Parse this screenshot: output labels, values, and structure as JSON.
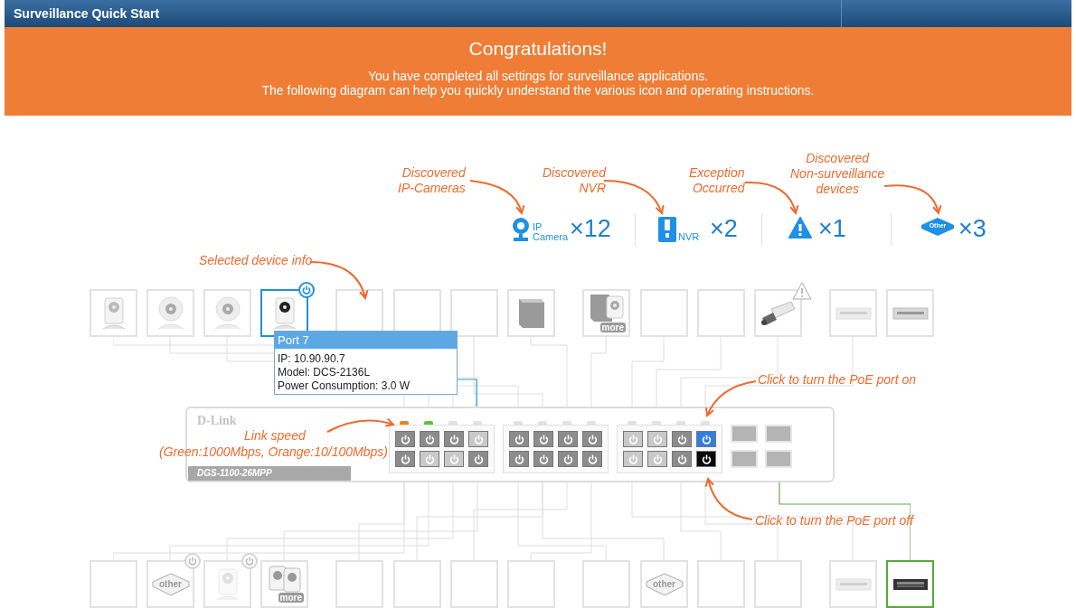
{
  "header": {
    "title": "Surveillance Quick Start"
  },
  "banner": {
    "heading": "Congratulations!",
    "lines": [
      "You have completed all settings for surveillance applications.",
      "The following diagram can help you quickly understand the various icon and operating instructions."
    ]
  },
  "legend": [
    {
      "kind": "camera",
      "label_lines": [
        "Discovered",
        "IP-Cameras"
      ],
      "icon_text": [
        "IP",
        "Camera"
      ],
      "count": "×12"
    },
    {
      "kind": "nvr",
      "label_lines": [
        "Discovered",
        "NVR"
      ],
      "icon_text": [
        "NVR"
      ],
      "count": "×2"
    },
    {
      "kind": "warning",
      "label_lines": [
        "Exception",
        "Occurred"
      ],
      "count": "×1"
    },
    {
      "kind": "other",
      "label_lines": [
        "Discovered",
        "Non-surveillance",
        "devices"
      ],
      "icon_text": [
        "Other"
      ],
      "count": "×3"
    }
  ],
  "callouts": [
    {
      "kind": "selected-info",
      "lines": [
        "Selected device info"
      ]
    },
    {
      "kind": "link-speed",
      "lines": [
        "Link speed",
        "(Green:1000Mbps, Orange:10/100Mbps)"
      ]
    },
    {
      "kind": "poe-on",
      "lines": [
        "Click to turn the PoE port on"
      ]
    },
    {
      "kind": "poe-off",
      "lines": [
        "Click to turn the PoE port off"
      ]
    }
  ],
  "top_devices": [
    {
      "kind": "cube-camera",
      "selected": false,
      "power_badge": false,
      "warning": false
    },
    {
      "kind": "round-camera",
      "selected": false,
      "power_badge": false,
      "warning": false
    },
    {
      "kind": "round-camera",
      "selected": false,
      "power_badge": false,
      "warning": false
    },
    {
      "kind": "cube-camera",
      "selected": true,
      "color": "#1e90e6",
      "power_badge": true,
      "warning": false
    },
    {
      "kind": "empty",
      "selected": false,
      "power_badge": false,
      "warning": false
    },
    {
      "kind": "empty",
      "selected": false,
      "power_badge": false,
      "warning": false
    },
    {
      "kind": "empty",
      "selected": false,
      "power_badge": false,
      "warning": false
    },
    {
      "kind": "nvr",
      "selected": false,
      "power_badge": false,
      "warning": false
    },
    {
      "kind": "nvr-more",
      "selected": false,
      "tag": "more",
      "power_badge": false,
      "warning": false
    },
    {
      "kind": "empty",
      "selected": false,
      "power_badge": false,
      "warning": false
    },
    {
      "kind": "empty",
      "selected": false,
      "power_badge": false,
      "warning": false
    },
    {
      "kind": "bullet-camera",
      "selected": false,
      "power_badge": false,
      "warning": true
    },
    {
      "kind": "switch",
      "selected": false,
      "dimmed": true,
      "power_badge": false,
      "warning": false
    },
    {
      "kind": "switch",
      "selected": false,
      "power_badge": false,
      "warning": false
    }
  ],
  "bottom_devices": [
    {
      "kind": "empty",
      "selected": false,
      "power_badge": false,
      "warning": false
    },
    {
      "kind": "other",
      "selected": false,
      "tag": "other",
      "power_badge": true,
      "warning": false
    },
    {
      "kind": "cube-camera",
      "selected": false,
      "dimmed": true,
      "power_badge": true,
      "warning": false
    },
    {
      "kind": "camera-more",
      "selected": false,
      "tag": "more",
      "power_badge": false,
      "warning": false
    },
    {
      "kind": "empty",
      "selected": false,
      "power_badge": false,
      "warning": false
    },
    {
      "kind": "empty",
      "selected": false,
      "power_badge": false,
      "warning": false
    },
    {
      "kind": "empty",
      "selected": false,
      "power_badge": false,
      "warning": false
    },
    {
      "kind": "empty",
      "selected": false,
      "power_badge": false,
      "warning": false
    },
    {
      "kind": "empty",
      "selected": false,
      "power_badge": false,
      "warning": false
    },
    {
      "kind": "other",
      "selected": false,
      "tag": "other",
      "power_badge": false,
      "warning": false
    },
    {
      "kind": "empty",
      "selected": false,
      "power_badge": false,
      "warning": false
    },
    {
      "kind": "empty",
      "selected": false,
      "power_badge": false,
      "warning": false
    },
    {
      "kind": "switch",
      "selected": false,
      "dimmed": true,
      "power_badge": false,
      "warning": false
    },
    {
      "kind": "dark-switch",
      "selected": true,
      "color": "#5aa83c",
      "power_badge": false,
      "warning": false
    }
  ],
  "tooltip": {
    "title": "Port 7",
    "lines": [
      "IP: 10.90.90.7",
      "Model: DCS-2136L",
      "Power Consumption: 3.0 W"
    ]
  },
  "switch": {
    "brand": "D-Link",
    "model": "DGS-1100-26MPP",
    "port_groups": [
      {
        "ports": [
          {
            "kind": "active",
            "color": "#e8841c"
          },
          {
            "kind": "active",
            "color": "#5cc23c"
          },
          {
            "kind": "active"
          },
          {
            "kind": "inactive"
          },
          {
            "kind": "active"
          },
          {
            "kind": "inactive"
          },
          {
            "kind": "inactive"
          },
          {
            "kind": "active"
          }
        ]
      },
      {
        "ports": [
          {
            "kind": "active"
          },
          {
            "kind": "active"
          },
          {
            "kind": "active"
          },
          {
            "kind": "active"
          },
          {
            "kind": "active"
          },
          {
            "kind": "active"
          },
          {
            "kind": "active"
          },
          {
            "kind": "active"
          }
        ]
      },
      {
        "ports": [
          {
            "kind": "inactive"
          },
          {
            "kind": "inactive"
          },
          {
            "kind": "active"
          },
          {
            "kind": "highlight-on"
          },
          {
            "kind": "inactive"
          },
          {
            "kind": "inactive"
          },
          {
            "kind": "active"
          },
          {
            "kind": "highlight-off"
          }
        ]
      }
    ],
    "sfp_ports": [
      {
        "kind": "sfp"
      },
      {
        "kind": "sfp"
      },
      {
        "kind": "sfp"
      },
      {
        "kind": "sfp"
      }
    ]
  }
}
